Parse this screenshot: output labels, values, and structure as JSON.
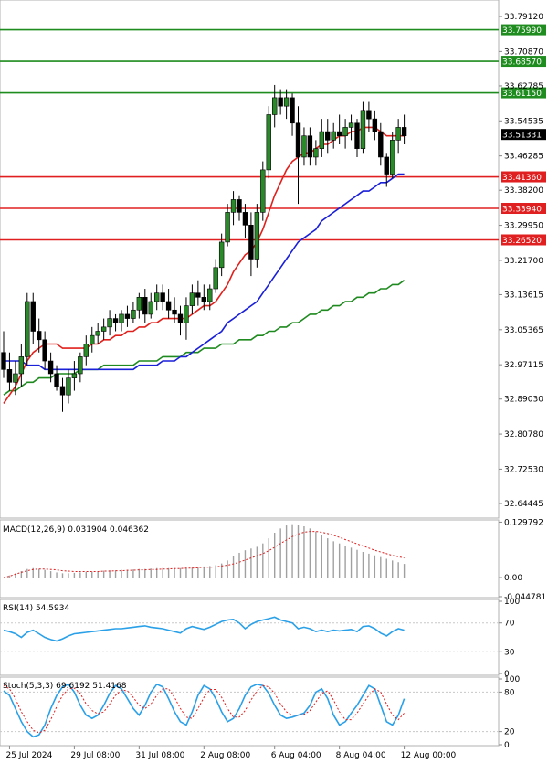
{
  "chart_data": {
    "type": "candlestick",
    "price_panel": {
      "y_ticks": [
        "33.79120",
        "33.70870",
        "33.62785",
        "33.54535",
        "33.46285",
        "33.38200",
        "33.29950",
        "33.21700",
        "33.13615",
        "33.05365",
        "32.97115",
        "32.89030",
        "32.80780",
        "32.72530",
        "32.64445"
      ],
      "ylim": [
        32.61,
        33.83
      ],
      "last_price": "33.51331",
      "horizontal_levels": [
        {
          "label": "33.75990",
          "value": 33.7599,
          "color": "#1e8c1e"
        },
        {
          "label": "33.68570",
          "value": 33.6857,
          "color": "#1e8c1e"
        },
        {
          "label": "33.61150",
          "value": 33.6115,
          "color": "#1e8c1e"
        },
        {
          "label": "33.41360",
          "value": 33.4136,
          "color": "#e02020"
        },
        {
          "label": "33.33940",
          "value": 33.3394,
          "color": "#e02020"
        },
        {
          "label": "33.26520",
          "value": 33.2652,
          "color": "#e02020"
        }
      ],
      "candles": [
        [
          33.0,
          33.05,
          32.94,
          32.96
        ],
        [
          32.96,
          33.0,
          32.91,
          32.93
        ],
        [
          32.93,
          32.98,
          32.9,
          32.95
        ],
        [
          32.95,
          33.02,
          32.92,
          32.99
        ],
        [
          32.99,
          33.14,
          32.97,
          33.12
        ],
        [
          33.12,
          33.14,
          33.02,
          33.05
        ],
        [
          33.05,
          33.08,
          33.0,
          33.03
        ],
        [
          33.03,
          33.05,
          32.96,
          32.98
        ],
        [
          32.98,
          33.0,
          32.93,
          32.95
        ],
        [
          32.95,
          32.97,
          32.91,
          32.92
        ],
        [
          32.92,
          32.94,
          32.86,
          32.9
        ],
        [
          32.9,
          32.96,
          32.88,
          32.94
        ],
        [
          32.94,
          32.98,
          32.91,
          32.95
        ],
        [
          32.95,
          33.0,
          32.93,
          32.99
        ],
        [
          32.99,
          33.04,
          32.97,
          33.02
        ],
        [
          33.02,
          33.06,
          33.0,
          33.04
        ],
        [
          33.04,
          33.07,
          33.02,
          33.05
        ],
        [
          33.05,
          33.08,
          33.03,
          33.06
        ],
        [
          33.06,
          33.1,
          33.04,
          33.08
        ],
        [
          33.08,
          33.09,
          33.05,
          33.07
        ],
        [
          33.07,
          33.1,
          33.05,
          33.09
        ],
        [
          33.09,
          33.11,
          33.06,
          33.08
        ],
        [
          33.08,
          33.12,
          33.07,
          33.1
        ],
        [
          33.1,
          33.14,
          33.08,
          33.13
        ],
        [
          33.13,
          33.15,
          33.07,
          33.09
        ],
        [
          33.09,
          33.14,
          33.08,
          33.12
        ],
        [
          33.12,
          33.16,
          33.1,
          33.14
        ],
        [
          33.14,
          33.16,
          33.1,
          33.12
        ],
        [
          33.12,
          33.15,
          33.08,
          33.1
        ],
        [
          33.1,
          33.13,
          33.07,
          33.09
        ],
        [
          33.09,
          33.11,
          33.04,
          33.07
        ],
        [
          33.07,
          33.13,
          33.03,
          33.11
        ],
        [
          33.11,
          33.16,
          33.09,
          33.14
        ],
        [
          33.14,
          33.17,
          33.11,
          33.13
        ],
        [
          33.13,
          33.16,
          33.1,
          33.12
        ],
        [
          33.12,
          33.16,
          33.1,
          33.15
        ],
        [
          33.15,
          33.22,
          33.14,
          33.2
        ],
        [
          33.2,
          33.28,
          33.18,
          33.26
        ],
        [
          33.26,
          33.35,
          33.25,
          33.33
        ],
        [
          33.33,
          33.38,
          33.3,
          33.36
        ],
        [
          33.36,
          33.37,
          33.31,
          33.33
        ],
        [
          33.33,
          33.35,
          33.27,
          33.3
        ],
        [
          33.3,
          33.33,
          33.18,
          33.22
        ],
        [
          33.22,
          33.35,
          33.2,
          33.33
        ],
        [
          33.33,
          33.45,
          33.31,
          33.43
        ],
        [
          33.43,
          33.58,
          33.41,
          33.56
        ],
        [
          33.56,
          33.63,
          33.53,
          33.6
        ],
        [
          33.6,
          33.62,
          33.56,
          33.58
        ],
        [
          33.58,
          33.62,
          33.55,
          33.6
        ],
        [
          33.6,
          33.61,
          33.51,
          33.54
        ],
        [
          33.54,
          33.58,
          33.35,
          33.46
        ],
        [
          33.46,
          33.53,
          33.44,
          33.51
        ],
        [
          33.51,
          33.53,
          33.44,
          33.46
        ],
        [
          33.46,
          33.5,
          33.44,
          33.48
        ],
        [
          33.48,
          33.55,
          33.46,
          33.52
        ],
        [
          33.52,
          33.55,
          33.47,
          33.5
        ],
        [
          33.5,
          33.54,
          33.48,
          33.52
        ],
        [
          33.52,
          33.56,
          33.49,
          33.51
        ],
        [
          33.51,
          33.55,
          33.48,
          33.53
        ],
        [
          33.53,
          33.56,
          33.5,
          33.54
        ],
        [
          33.54,
          33.55,
          33.46,
          33.48
        ],
        [
          33.48,
          33.59,
          33.47,
          33.57
        ],
        [
          33.57,
          33.59,
          33.52,
          33.55
        ],
        [
          33.55,
          33.57,
          33.5,
          33.52
        ],
        [
          33.52,
          33.54,
          33.44,
          33.46
        ],
        [
          33.46,
          33.47,
          33.39,
          33.42
        ],
        [
          33.42,
          33.52,
          33.41,
          33.5
        ],
        [
          33.5,
          33.55,
          33.47,
          33.53
        ],
        [
          33.53,
          33.56,
          33.49,
          33.51
        ]
      ],
      "ma_fast": {
        "color": "#e0201c",
        "values": [
          32.88,
          32.9,
          32.92,
          32.95,
          32.98,
          33.0,
          33.01,
          33.02,
          33.02,
          33.02,
          33.01,
          33.01,
          33.01,
          33.01,
          33.01,
          33.02,
          33.02,
          33.03,
          33.03,
          33.04,
          33.04,
          33.05,
          33.05,
          33.06,
          33.06,
          33.07,
          33.07,
          33.08,
          33.08,
          33.08,
          33.08,
          33.08,
          33.09,
          33.1,
          33.11,
          33.11,
          33.12,
          33.14,
          33.16,
          33.19,
          33.21,
          33.23,
          33.24,
          33.26,
          33.29,
          33.33,
          33.37,
          33.4,
          33.43,
          33.45,
          33.46,
          33.47,
          33.47,
          33.48,
          33.49,
          33.49,
          33.5,
          33.51,
          33.51,
          33.52,
          33.52,
          33.53,
          33.53,
          33.53,
          33.52,
          33.51,
          33.51,
          33.51,
          33.51
        ]
      },
      "ma_mid": {
        "color": "#1a1fd8",
        "values": [
          32.98,
          32.98,
          32.98,
          32.98,
          32.97,
          32.97,
          32.97,
          32.96,
          32.96,
          32.96,
          32.96,
          32.96,
          32.96,
          32.96,
          32.96,
          32.96,
          32.96,
          32.96,
          32.96,
          32.96,
          32.96,
          32.96,
          32.96,
          32.97,
          32.97,
          32.97,
          32.97,
          32.98,
          32.98,
          32.98,
          32.99,
          32.99,
          33.0,
          33.01,
          33.02,
          33.03,
          33.04,
          33.05,
          33.07,
          33.08,
          33.09,
          33.1,
          33.11,
          33.12,
          33.14,
          33.16,
          33.18,
          33.2,
          33.22,
          33.24,
          33.26,
          33.27,
          33.28,
          33.29,
          33.31,
          33.32,
          33.33,
          33.34,
          33.35,
          33.36,
          33.37,
          33.38,
          33.38,
          33.39,
          33.4,
          33.4,
          33.41,
          33.42,
          33.42
        ]
      },
      "ma_slow": {
        "color": "#1f8a1f",
        "values": [
          32.9,
          32.91,
          32.91,
          32.92,
          32.93,
          32.93,
          32.94,
          32.94,
          32.94,
          32.95,
          32.95,
          32.95,
          32.95,
          32.96,
          32.96,
          32.96,
          32.96,
          32.97,
          32.97,
          32.97,
          32.97,
          32.97,
          32.97,
          32.98,
          32.98,
          32.98,
          32.98,
          32.99,
          32.99,
          32.99,
          32.99,
          33.0,
          33.0,
          33.0,
          33.01,
          33.01,
          33.01,
          33.02,
          33.02,
          33.02,
          33.03,
          33.03,
          33.03,
          33.04,
          33.04,
          33.05,
          33.05,
          33.06,
          33.06,
          33.07,
          33.07,
          33.08,
          33.09,
          33.09,
          33.1,
          33.1,
          33.11,
          33.11,
          33.12,
          33.12,
          33.13,
          33.13,
          33.14,
          33.14,
          33.15,
          33.15,
          33.16,
          33.16,
          33.17
        ]
      }
    },
    "macd_panel": {
      "label": "MACD(12,26,9) 0.031904 0.046362",
      "y_ticks": [
        "0.129792",
        "0.00",
        "-0.044781"
      ],
      "ylim": [
        -0.047,
        0.135
      ],
      "histogram": [
        0.0,
        0.005,
        0.01,
        0.015,
        0.02,
        0.022,
        0.02,
        0.018,
        0.015,
        0.012,
        0.01,
        0.01,
        0.011,
        0.012,
        0.013,
        0.014,
        0.015,
        0.016,
        0.017,
        0.017,
        0.018,
        0.018,
        0.019,
        0.02,
        0.02,
        0.021,
        0.022,
        0.022,
        0.022,
        0.022,
        0.022,
        0.023,
        0.024,
        0.025,
        0.026,
        0.027,
        0.029,
        0.033,
        0.04,
        0.05,
        0.058,
        0.064,
        0.068,
        0.072,
        0.08,
        0.092,
        0.105,
        0.115,
        0.122,
        0.125,
        0.124,
        0.12,
        0.115,
        0.108,
        0.1,
        0.092,
        0.085,
        0.08,
        0.075,
        0.07,
        0.065,
        0.06,
        0.056,
        0.052,
        0.048,
        0.044,
        0.04,
        0.036,
        0.032
      ],
      "signal": [
        0.0,
        0.003,
        0.008,
        0.012,
        0.016,
        0.019,
        0.02,
        0.02,
        0.019,
        0.018,
        0.016,
        0.015,
        0.014,
        0.014,
        0.014,
        0.014,
        0.014,
        0.015,
        0.015,
        0.016,
        0.016,
        0.017,
        0.017,
        0.018,
        0.018,
        0.019,
        0.019,
        0.02,
        0.02,
        0.021,
        0.021,
        0.022,
        0.022,
        0.023,
        0.024,
        0.024,
        0.025,
        0.027,
        0.029,
        0.032,
        0.036,
        0.041,
        0.046,
        0.051,
        0.056,
        0.063,
        0.071,
        0.08,
        0.088,
        0.096,
        0.102,
        0.106,
        0.108,
        0.108,
        0.106,
        0.103,
        0.099,
        0.094,
        0.089,
        0.084,
        0.079,
        0.074,
        0.069,
        0.064,
        0.06,
        0.056,
        0.052,
        0.049,
        0.046
      ]
    },
    "rsi_panel": {
      "label": "RSI(14) 54.5934",
      "y_ticks": [
        "100",
        "70",
        "30",
        "0"
      ],
      "ylim": [
        0,
        100
      ],
      "values": [
        60,
        58,
        55,
        50,
        57,
        60,
        55,
        50,
        47,
        45,
        48,
        52,
        55,
        56,
        57,
        58,
        59,
        60,
        61,
        62,
        62,
        63,
        64,
        65,
        66,
        64,
        63,
        62,
        60,
        58,
        56,
        62,
        65,
        63,
        61,
        64,
        68,
        72,
        74,
        75,
        70,
        62,
        68,
        72,
        74,
        76,
        78,
        74,
        72,
        70,
        62,
        64,
        62,
        58,
        60,
        58,
        60,
        59,
        60,
        61,
        58,
        65,
        66,
        62,
        56,
        52,
        58,
        62,
        60
      ]
    },
    "stoch_panel": {
      "label": "Stoch(5,3,3) 69.6192 51.4168",
      "y_ticks": [
        "100",
        "80",
        "20",
        "0"
      ],
      "ylim": [
        0,
        100
      ],
      "k": [
        82,
        75,
        55,
        35,
        20,
        12,
        15,
        30,
        55,
        75,
        88,
        92,
        80,
        60,
        45,
        40,
        45,
        60,
        78,
        90,
        85,
        70,
        55,
        45,
        60,
        80,
        92,
        88,
        70,
        50,
        35,
        30,
        50,
        75,
        90,
        85,
        70,
        50,
        35,
        40,
        55,
        75,
        88,
        92,
        90,
        78,
        60,
        45,
        40,
        42,
        45,
        48,
        60,
        80,
        85,
        70,
        45,
        30,
        35,
        48,
        60,
        75,
        90,
        85,
        60,
        35,
        30,
        45,
        70
      ],
      "d": [
        90,
        85,
        70,
        50,
        35,
        22,
        18,
        22,
        38,
        58,
        75,
        85,
        86,
        78,
        62,
        52,
        47,
        50,
        62,
        75,
        83,
        82,
        72,
        60,
        55,
        62,
        75,
        85,
        85,
        72,
        55,
        42,
        40,
        55,
        72,
        84,
        84,
        72,
        55,
        42,
        42,
        52,
        68,
        82,
        90,
        88,
        78,
        62,
        50,
        45,
        45,
        46,
        52,
        65,
        78,
        82,
        68,
        50,
        38,
        38,
        48,
        62,
        75,
        85,
        80,
        62,
        45,
        38,
        48
      ]
    },
    "x_tick_labels": [
      "25 Jul 2024",
      "29 Jul 08:00",
      "31 Jul 08:00",
      "2 Aug 08:00",
      "6 Aug 04:00",
      "8 Aug 04:00",
      "12 Aug 00:00"
    ],
    "x_tick_index": [
      1,
      12,
      23,
      34,
      46,
      57,
      68
    ]
  }
}
